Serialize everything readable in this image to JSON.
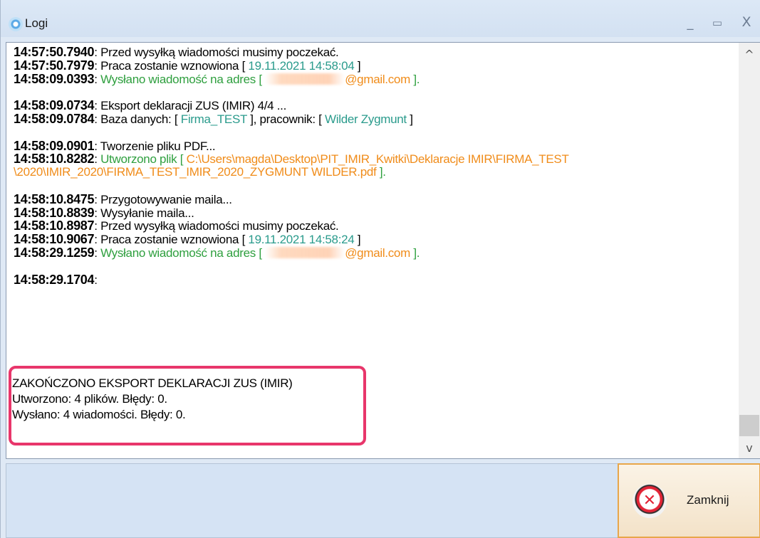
{
  "window": {
    "title": "Logi",
    "min_symbol": "_",
    "max_symbol": "▭",
    "close_symbol": "X"
  },
  "log": [
    {
      "ts": "14:57:50.7940",
      "sep": ":",
      "parts": [
        {
          "t": "  Przed wysyłką wiadomości musimy poczekać.",
          "c": ""
        }
      ]
    },
    {
      "ts": "14:57:50.7979",
      "sep": ":",
      "parts": [
        {
          "t": "  Praca zostanie wznowiona [ ",
          "c": ""
        },
        {
          "t": "19.11.2021 14:58:04",
          "c": "teal"
        },
        {
          "t": " ]",
          "c": ""
        }
      ]
    },
    {
      "ts": "14:58:09.0393",
      "sep": ":",
      "parts": [
        {
          "t": "  Wysłano wiadomość na adres [ ",
          "c": "green"
        },
        {
          "t": "",
          "c": "blur"
        },
        {
          "t": "@gmail.com",
          "c": "orange"
        },
        {
          "t": " ].",
          "c": "green"
        }
      ]
    },
    {
      "blank": true
    },
    {
      "ts": "14:58:09.0734",
      "sep": ":",
      "parts": [
        {
          "t": "  Eksport deklaracji ZUS (IMIR) 4/4 ...",
          "c": ""
        }
      ]
    },
    {
      "ts": "14:58:09.0784",
      "sep": ":",
      "parts": [
        {
          "t": "  Baza danych: [ ",
          "c": ""
        },
        {
          "t": "Firma_TEST",
          "c": "teal"
        },
        {
          "t": " ], pracownik: [ ",
          "c": ""
        },
        {
          "t": "Wilder Zygmunt",
          "c": "teal"
        },
        {
          "t": " ]",
          "c": ""
        }
      ]
    },
    {
      "blank": true
    },
    {
      "ts": "14:58:09.0901",
      "sep": ":",
      "parts": [
        {
          "t": "  Tworzenie pliku PDF...",
          "c": ""
        }
      ]
    },
    {
      "ts": "14:58:10.8282",
      "sep": ":",
      "parts": [
        {
          "t": "  Utworzono plik [ ",
          "c": "green"
        },
        {
          "t": "C:\\Users\\magda\\Desktop\\PIT_IMIR_Kwitki\\Deklaracje IMIR\\FIRMA_TEST",
          "c": "orange"
        }
      ]
    },
    {
      "ts": "",
      "sep": "",
      "parts": [
        {
          "t": "\\2020\\IMIR_2020\\FIRMA_TEST_IMIR_2020_ZYGMUNT WILDER.pdf",
          "c": "orange"
        },
        {
          "t": " ].",
          "c": "green"
        }
      ]
    },
    {
      "blank": true
    },
    {
      "ts": "14:58:10.8475",
      "sep": ":",
      "parts": [
        {
          "t": "  Przygotowywanie maila...",
          "c": ""
        }
      ]
    },
    {
      "ts": "14:58:10.8839",
      "sep": ":",
      "parts": [
        {
          "t": "  Wysyłanie maila...",
          "c": ""
        }
      ]
    },
    {
      "ts": "14:58:10.8987",
      "sep": ":",
      "parts": [
        {
          "t": "  Przed wysyłką wiadomości musimy poczekać.",
          "c": ""
        }
      ]
    },
    {
      "ts": "14:58:10.9067",
      "sep": ":",
      "parts": [
        {
          "t": "  Praca zostanie wznowiona [ ",
          "c": ""
        },
        {
          "t": "19.11.2021 14:58:24",
          "c": "teal"
        },
        {
          "t": " ]",
          "c": ""
        }
      ]
    },
    {
      "ts": "14:58:29.1259",
      "sep": ":",
      "parts": [
        {
          "t": "  Wysłano wiadomość na adres [ ",
          "c": "green"
        },
        {
          "t": "",
          "c": "blur"
        },
        {
          "t": "@gmail.com",
          "c": "orange"
        },
        {
          "t": " ].",
          "c": "green"
        }
      ]
    },
    {
      "blank": true
    },
    {
      "ts": "14:58:29.1704",
      "sep": ":",
      "parts": []
    }
  ],
  "summary": {
    "line1": "ZAKOŃCZONO EKSPORT DEKLARACJI ZUS (IMIR)",
    "line2": "Utworzono: 4 plików. Błędy: 0.",
    "line3": "Wysłano: 4 wiadomości. Błędy: 0."
  },
  "scrollbar": {
    "up_symbol": "^",
    "down_symbol": "v"
  },
  "button": {
    "close_label": "Zamknij",
    "close_glyph": "✕"
  },
  "colors": {
    "green": "#2e9f3e",
    "teal": "#2a9b8c",
    "orange": "#f08c1a",
    "highlight": "#e8366b"
  }
}
